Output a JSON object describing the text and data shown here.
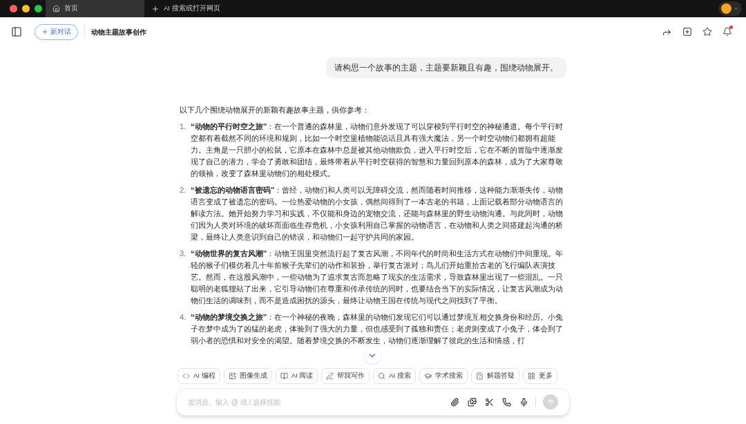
{
  "browser": {
    "tabs": [
      {
        "label": "首页",
        "selected": true,
        "kind": "home"
      },
      {
        "label": "AI 搜索或打开网页",
        "selected": false,
        "kind": "new"
      }
    ]
  },
  "header": {
    "new_chat": "新对话",
    "title": "动物主题故事创作",
    "notification_dot": true
  },
  "user_message": "请构思一个故事的主题，主题要新颖且有趣，围绕动物展开。",
  "reply": {
    "intro": "以下几个围绕动物展开的新颖有趣故事主题，供你参考：",
    "items": [
      {
        "number": "1.",
        "text": "**“动物的平行时空之旅”**：在一个普通的森林里，动物们意外发现了可以穿梭到平行时空的神秘通道。每个平行时空都有着截然不同的环境和规则，比如一个时空里植物能说话且具有强大魔法，另一个时空动物们都拥有超能力。主角是一只胆小的松鼠，它原本在森林中总是被其他动物欺负，进入平行时空后，它在不断的冒险中逐渐发现了自己的潜力，学会了勇敢和团结，最终带着从平行时空获得的智慧和力量回到原本的森林，成为了大家尊敬的领袖，改变了森林里动物们的相处模式。"
      },
      {
        "number": "2.",
        "text": "**“被遗忘的动物语言密码”**：曾经，动物们和人类可以无障碍交流，然而随着时间推移，这种能力渐渐失传，动物语言变成了被遗忘的密码。一位热爱动物的小女孩，偶然间得到了一本古老的书籍，上面记载着部分动物语言的解读方法。她开始努力学习和实践，不仅能和身边的宠物交流，还能与森林里的野生动物沟通。与此同时，动物们因为人类对环境的破坏而面临生存危机，小女孩利用自己掌握的动物语言，在动物和人类之间搭建起沟通的桥梁，最终让人类意识到自己的错误，和动物们一起守护共同的家园。"
      },
      {
        "number": "3.",
        "text": "**“动物世界的复古风潮”**：动物王国里突然流行起了复古风潮，不同年代的时尚和生活方式在动物们中间重现。年轻的猴子们模仿着几十年前猴子先辈们的动作和装扮，举行复古派对；鸟儿们开始重拾古老的飞行编队表演技艺。然而，在这股风潮中，一些动物为了追求复古而忽略了现实的生活需求，导致森林里出现了一些混乱。一只聪明的老狐狸站了出来，它引导动物们在尊重和传承传统的同时，也要结合当下的实际情况，让复古风潮成为动物们生活的调味剂，而不是造成困扰的源头，最终让动物王国在传统与现代之间找到了平衡。"
      },
      {
        "number": "4.",
        "text": "**“动物的梦境交换之旅”**：在一个神秘的夜晚，森林里的动物们发现它们可以通过梦境互相交换身份和经历。小兔子在梦中成为了凶猛的老虎，体验到了强大的力量，但也感受到了孤独和责任；老虎则变成了小兔子，体会到了弱小者的恐惧和对安全的渴望。随着梦境交换的不断发生，动物们逐渐理解了彼此的生活和情感，打"
      }
    ]
  },
  "tools": [
    {
      "label": "AI 编程",
      "kind": "code"
    },
    {
      "label": "图像生成",
      "kind": "image"
    },
    {
      "label": "AI 阅读",
      "kind": "read"
    },
    {
      "label": "帮我写作",
      "kind": "write"
    },
    {
      "label": "AI 搜索",
      "kind": "search"
    },
    {
      "label": "学术搜索",
      "kind": "academic"
    },
    {
      "label": "解题答疑",
      "kind": "solve"
    },
    {
      "label": "更多",
      "kind": "more"
    }
  ],
  "composer": {
    "placeholder": "发消息、输入 @ 或 / 选择技能",
    "send_disabled": true
  }
}
